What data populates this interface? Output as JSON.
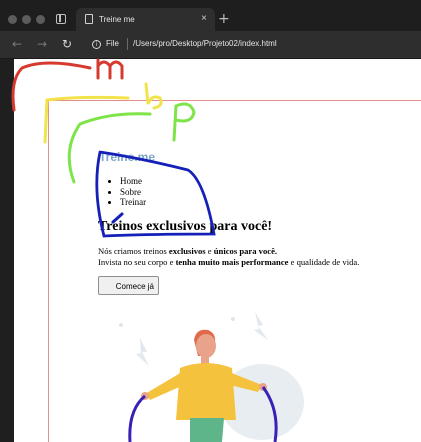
{
  "browser": {
    "tab_title": "Treine me",
    "tab_close": "×",
    "new_tab": "+",
    "back_icon": "←",
    "forward_icon": "→",
    "reload_icon": "↻",
    "info_icon": "i",
    "scheme_label": "File",
    "url": "/Users/pro/Desktop/Projeto02/index.html"
  },
  "site": {
    "logo": "Treine.me",
    "menu": [
      "Home",
      "Sobre",
      "Treinar"
    ],
    "hero": {
      "title": "Treinos exclusivos para você!",
      "line1_pre": "Nós criamos treinos ",
      "line1_bold1": "exclusivos",
      "line1_mid": " e ",
      "line1_bold2": "únicos para você.",
      "line2_pre": "Invista no seu corpo e ",
      "line2_bold": "tenha muito mais performance",
      "line2_post": " e qualidade de vida.",
      "cta": "Comece já"
    }
  },
  "annotations": {
    "letters": [
      "m",
      "b",
      "p"
    ],
    "colors": {
      "red": "#d63a2f",
      "yellow": "#f2e34a",
      "green": "#7fe34a",
      "blue": "#1420b8"
    }
  },
  "illustration": {
    "name": "person-jumping-rope",
    "colors": {
      "skin": "#e9a38b",
      "hair": "#e06a4a",
      "shirt": "#f5c23d",
      "pants": "#5fb58a",
      "rope": "#3a21b5",
      "blob": "#e8edf2"
    }
  }
}
